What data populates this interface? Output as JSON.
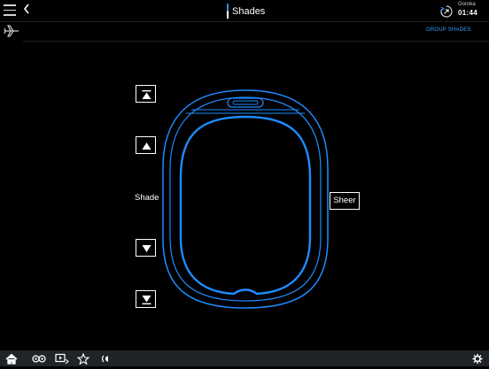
{
  "header": {
    "title": "Shades",
    "location": "Goroka",
    "time": "01:44"
  },
  "subheader": {
    "group_shades_label": "GROUP SHADES"
  },
  "controls": {
    "shade_label": "Shade",
    "sheer_label": "Sheer"
  },
  "colors": {
    "accent": "#2b8bff",
    "window_outline": "#1e8cff",
    "background": "#000000",
    "bottom_bar": "#202428"
  },
  "icons": {
    "menu": "menu-icon",
    "back": "chevron-left-icon",
    "clock": "flight-clock-icon",
    "plane": "airplane-icon",
    "full_up": "full-open-arrow-icon",
    "up": "arrow-up-icon",
    "down": "arrow-down-icon",
    "full_down": "full-close-arrow-icon",
    "home": "home-icon",
    "media": "media-icon",
    "video": "video-icon",
    "favorites": "star-icon",
    "audio": "audio-icon",
    "settings": "gear-icon"
  }
}
